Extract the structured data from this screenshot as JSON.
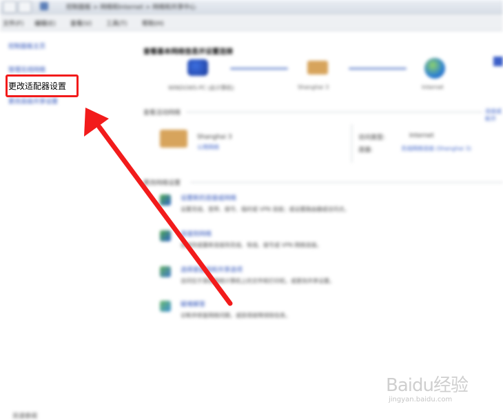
{
  "window": {
    "breadcrumb": "控制面板 > 网络和Internet > 网络和共享中心"
  },
  "menu": {
    "items": [
      "文件(F)",
      "编辑(E)",
      "查看(V)",
      "工具(T)",
      "帮助(H)"
    ]
  },
  "sidebar": {
    "items": [
      {
        "label": "控制面板主页"
      },
      {
        "label": "管理无线网络"
      },
      {
        "label": "更改适配器设置"
      },
      {
        "label": "更改高级共享设置"
      }
    ]
  },
  "main": {
    "heading": "查看基本网络信息并设置连接",
    "map": {
      "computer_label": "WINDOWS-PC (此计算机)",
      "network_label": "Shanghai 3",
      "internet_label": "Internet"
    },
    "active_networks_header": "查看活动网络",
    "active_networks_link": "连接或断开",
    "network": {
      "name": "Shanghai 3",
      "type": "公用网络",
      "access_type_label": "访问类型:",
      "access_type_value": "Internet",
      "connections_label": "连接:",
      "connections_value": "无线网络连接 (Shanghai 3)"
    },
    "change_settings_header": "更改网络设置",
    "tasks": [
      {
        "title": "设置新的连接或网络",
        "desc": "设置无线、宽带、拨号、临时或 VPN 连接；或设置路由器或访问点。"
      },
      {
        "title": "连接到网络",
        "desc": "连接到或重新连接到无线、有线、拨号或 VPN 网络连接。"
      },
      {
        "title": "选择家庭组和共享选项",
        "desc": "访问位于其他网络计算机上的文件和打印机，或更改共享设置。"
      },
      {
        "title": "疑难解答",
        "desc": "诊断并修复网络问题，或获得故障排除信息。"
      }
    ],
    "bottom_label": "另请参阅"
  },
  "watermark": {
    "logo": "Baidu经验",
    "url": "jingyan.baidu.com"
  },
  "colors": {
    "highlight": "#f21b1b",
    "arrow": "#f21b1b",
    "link": "#2a4fb8"
  }
}
